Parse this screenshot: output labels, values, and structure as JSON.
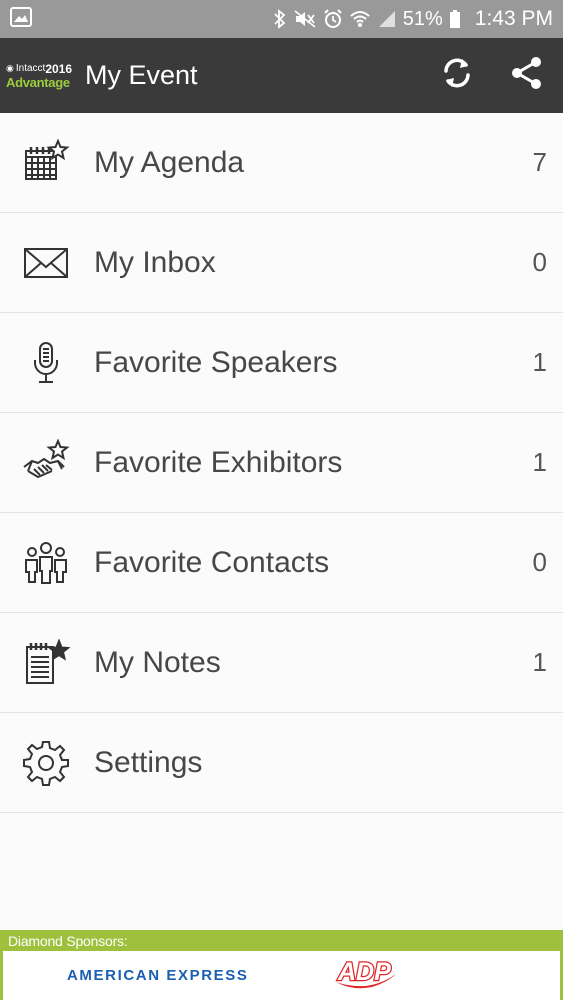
{
  "status_bar": {
    "battery": "51%",
    "time": "1:43 PM"
  },
  "app_bar": {
    "logo_top": "Intacct",
    "logo_year": "2016",
    "logo_bottom": "Advantage",
    "title": "My Event",
    "icons": [
      "sync-icon",
      "share-icon"
    ]
  },
  "menu": {
    "items": [
      {
        "label": "My Agenda",
        "count": "7",
        "icon": "calendar-star-icon"
      },
      {
        "label": "My Inbox",
        "count": "0",
        "icon": "envelope-icon"
      },
      {
        "label": "Favorite Speakers",
        "count": "1",
        "icon": "microphone-icon"
      },
      {
        "label": "Favorite Exhibitors",
        "count": "1",
        "icon": "handshake-star-icon"
      },
      {
        "label": "Favorite Contacts",
        "count": "0",
        "icon": "people-icon"
      },
      {
        "label": "My Notes",
        "count": "1",
        "icon": "notepad-star-icon"
      },
      {
        "label": "Settings",
        "count": "",
        "icon": "gear-icon"
      }
    ]
  },
  "sponsors": {
    "title": "Diamond Sponsors:",
    "names": [
      "AMERICAN EXPRESS",
      "ADP"
    ]
  },
  "colors": {
    "app_bar": "#3a3a3a",
    "status_bar": "#999999",
    "sponsor_green": "#9fc03c",
    "amex_blue": "#1b5fb0",
    "adp_red": "#e0262b"
  }
}
